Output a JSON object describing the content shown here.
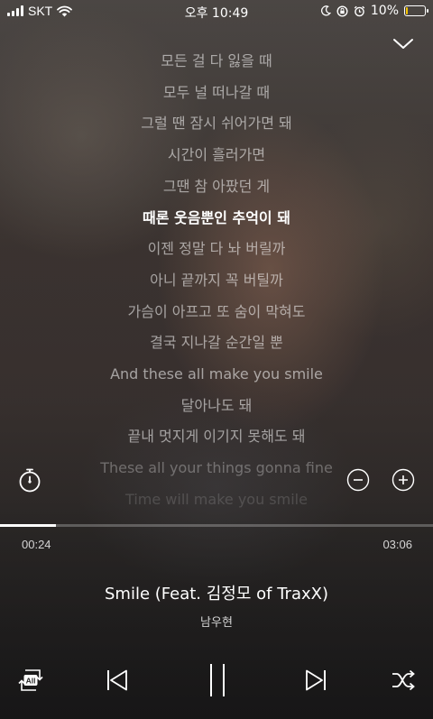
{
  "status_bar": {
    "carrier": "SKT",
    "time": "오후 10:49",
    "battery": "10%",
    "battery_level": 0.1,
    "battery_color": "#f5c400"
  },
  "header": {
    "collapse_icon": "chevron-down-icon"
  },
  "lyrics": {
    "lines": [
      {
        "text": "모든 걸 다 잃을 때",
        "state": "normal"
      },
      {
        "text": "모두 널 떠나갈 때",
        "state": "normal"
      },
      {
        "text": "그럴 땐 잠시 쉬어가면 돼",
        "state": "normal"
      },
      {
        "text": "시간이 흘러가면",
        "state": "normal"
      },
      {
        "text": "그땐 참 아팠던 게",
        "state": "normal"
      },
      {
        "text": "때론 웃음뿐인 추억이 돼",
        "state": "current"
      },
      {
        "text": "이젠 정말 다 놔 버릴까",
        "state": "normal"
      },
      {
        "text": "아니 끝까지 꼭 버틸까",
        "state": "normal"
      },
      {
        "text": "가슴이 아프고 또 숨이 막혀도",
        "state": "normal"
      },
      {
        "text": "결국 지나갈 순간일 뿐",
        "state": "normal"
      },
      {
        "text": "And these all make you smile",
        "state": "normal"
      },
      {
        "text": "달아나도 돼",
        "state": "normal"
      },
      {
        "text": "끝내 멋지게 이기지 못해도 돼",
        "state": "normal"
      },
      {
        "text": "These all your things gonna fine",
        "state": "faded"
      },
      {
        "text": "Time will make you smile",
        "state": "fading"
      }
    ],
    "timer_icon": "stopwatch-icon",
    "zoom_out_icon": "minus-circle-icon",
    "zoom_in_icon": "plus-circle-icon"
  },
  "player": {
    "elapsed": "00:24",
    "duration": "03:06",
    "progress": 0.13,
    "title": "Smile (Feat. 김정모 of TraxX)",
    "artist": "남우현",
    "repeat_label": "All"
  },
  "controls": {
    "repeat_icon": "repeat-all-icon",
    "previous_icon": "previous-icon",
    "pause_icon": "pause-icon",
    "next_icon": "next-icon",
    "shuffle_icon": "shuffle-icon"
  }
}
